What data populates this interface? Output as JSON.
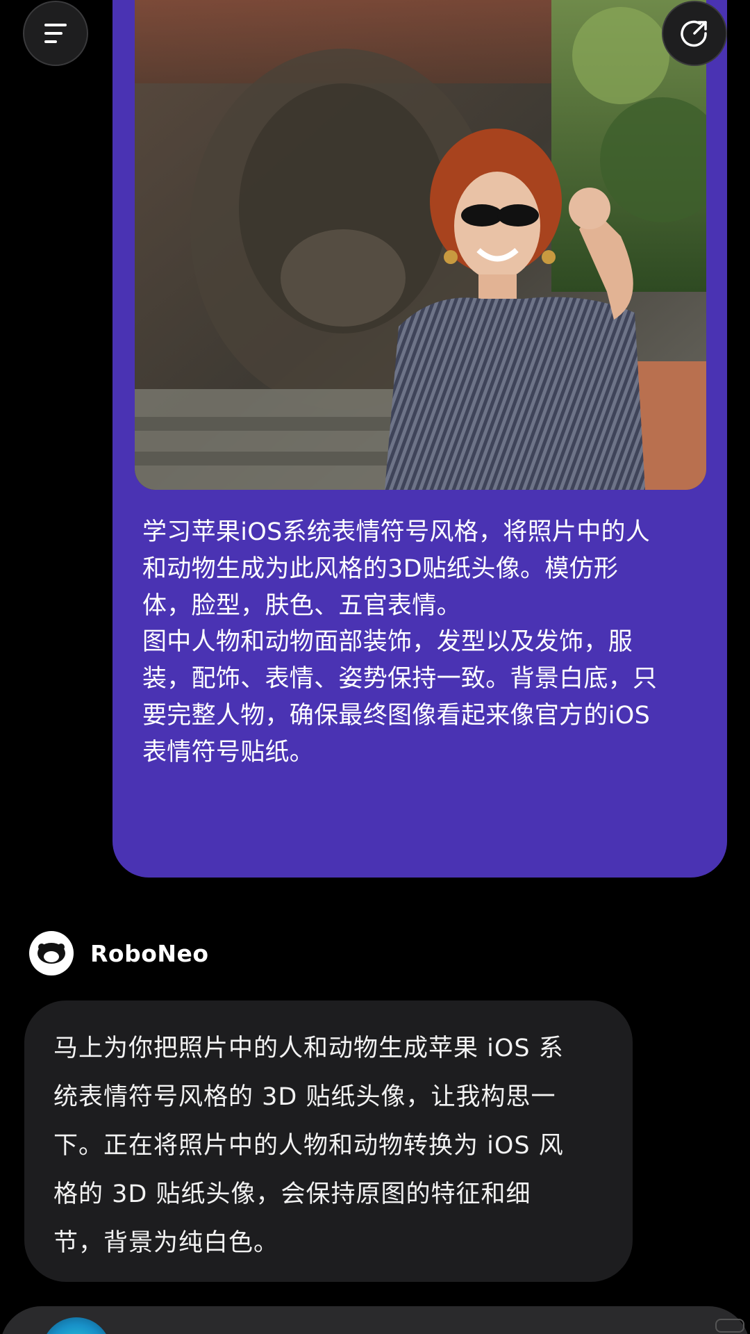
{
  "user_message": {
    "photo_description_icon": "photo-thumbnail",
    "prompt": "学习苹果iOS系统表情符号风格，将照片中的人\n和动物生成为此风格的3D贴纸头像。模仿形\n体，脸型，肤色、五官表情。\n图中人物和动物面部装饰，发型以及发饰，服\n装，配饰、表情、姿势保持一致。背景白底，只\n要完整人物，确保最终图像看起来像官方的iOS\n表情符号贴纸。"
  },
  "toolbar": {
    "menu_icon": "menu-icon",
    "share_icon": "share-icon"
  },
  "assistant": {
    "name": "RoboNeo",
    "reply": "马上为你把照片中的人和动物生成苹果 iOS 系\n统表情符号风格的 3D 贴纸头像，让我构思一\n下。正在将照片中的人物和动物转换为 iOS 风\n格的 3D 贴纸头像，会保持原图的特征和细\n节，背景为纯白色。"
  },
  "colors": {
    "user_bubble": "#4a33b3",
    "assistant_bubble": "#1d1d1f",
    "background": "#000000"
  }
}
